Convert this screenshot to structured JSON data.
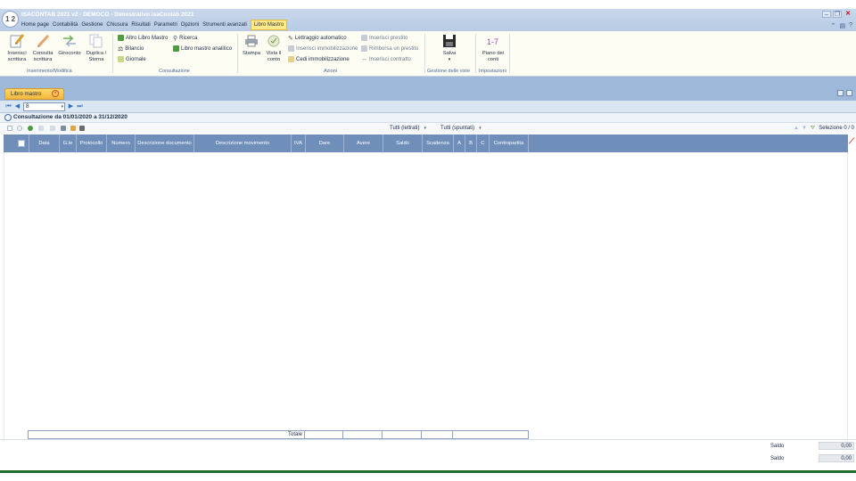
{
  "app": {
    "logo_text": "1 2 3",
    "title": "ISACONTAB 2021 v2 - DEMOCO - Dimostrativo IsaContab 2021"
  },
  "menu": [
    "Home page",
    "Contabilità",
    "Gestione",
    "Chiusura",
    "Risultati",
    "Parametri",
    "Opzioni",
    "Strumenti avanzati",
    "Libro Mastro"
  ],
  "menu_active": "Libro Mastro",
  "ribbon": {
    "groups": {
      "inserimento": "Inserimento/Modifica",
      "consultazione": "Consultazione",
      "azioni": "Azioni",
      "viste": "Gestione delle viste",
      "impostazioni": "Impostazioni"
    },
    "inserisci_scrittura": "Inserisci scrittura",
    "consulta_scrittura": "Consulta scrittura",
    "giroconto": "Giroconto",
    "duplica_storna": "Duplica / Storna",
    "altro_libro_mastro": "Altro Libro Mastro",
    "bilancio": "Bilancio",
    "giornale": "Giornale",
    "ricerca": "Ricerca",
    "libro_mastro_analitico": "Libro mastro analitico",
    "stampa": "Stampa",
    "vista_il_conto": "Vista il conto",
    "lettraggio_automatico": "Lettraggio automatico",
    "inserisci_immobilizzazione": "Inserisci immobilizzazione",
    "cedi_immobilizzazione": "Cedi immobilizzazione",
    "inserisci_prestito": "Inserisci prestito",
    "rimborsa_prestito": "Rimborsa un prestito",
    "inserisci_contratto": "Inserisci contratto",
    "salva": "Salva",
    "piano_dei_conti": "Piano dei conti"
  },
  "tab": {
    "label": "Libro mastro"
  },
  "nav": {
    "account_value": "8"
  },
  "consultation_text": "Consultazione da 01/01/2020 a 31/12/2020",
  "filters": {
    "lettrati": "Tutti (lettrati)",
    "spuntati": "Tutti (spuntati)"
  },
  "selection": "Selezione 0 / 0",
  "columns": [
    "Data",
    "G.le",
    "Protocollo",
    "Numero",
    "Descrizione documento",
    "Descrizione movimento",
    "IVA",
    "Dare",
    "Avere",
    "Saldo",
    "Scadenza",
    "A",
    "B",
    "C",
    "Contropartita"
  ],
  "totals_label": "Totale",
  "summary": [
    {
      "label": "Saldo",
      "value": "0,00"
    },
    {
      "label": "Saldo",
      "value": "0,00"
    }
  ],
  "colors": {
    "accent": "#ffe98a",
    "grid_header": "#6f8eba",
    "band": "#9eb8da"
  }
}
